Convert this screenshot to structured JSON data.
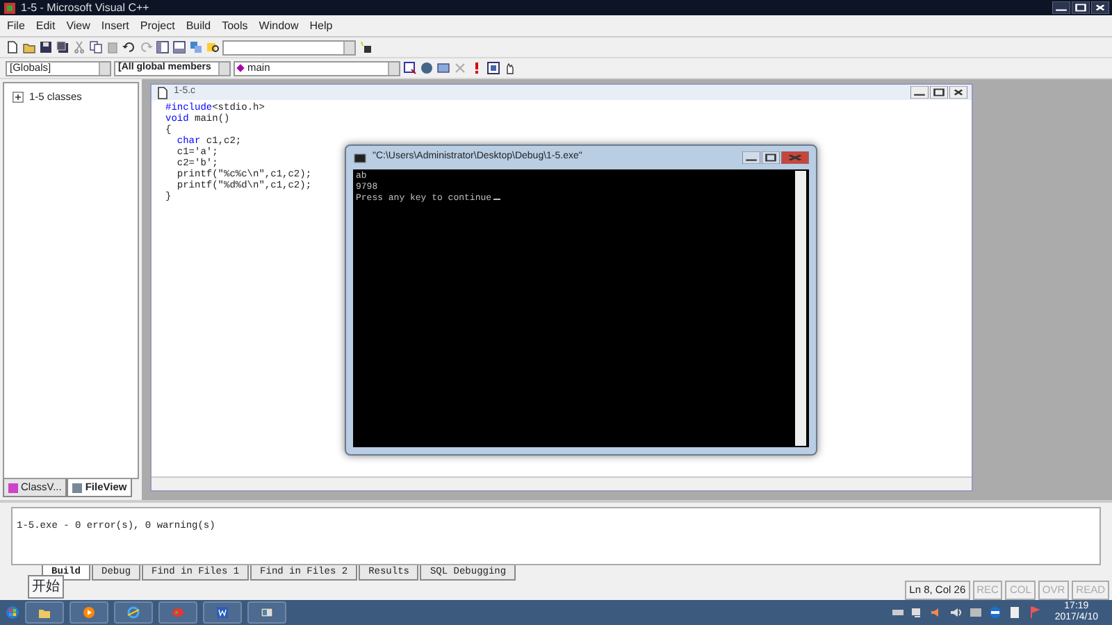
{
  "window": {
    "title": "1-5 - Microsoft Visual C++"
  },
  "menu": [
    "File",
    "Edit",
    "View",
    "Insert",
    "Project",
    "Build",
    "Tools",
    "Window",
    "Help"
  ],
  "wizard_bar": {
    "class_combo": "[Globals]",
    "filter_combo": "[All global members",
    "member_combo": "main"
  },
  "workspace": {
    "tree": [
      {
        "label": "1-5 classes",
        "expanded": false
      }
    ],
    "tabs": [
      {
        "label": "ClassV...",
        "selected": false
      },
      {
        "label": "FileView",
        "selected": true
      }
    ]
  },
  "editor": {
    "title": "1-5.c",
    "lines": [
      {
        "tokens": [
          {
            "kind": "keyword",
            "text": "#include"
          },
          {
            "kind": "plain",
            "text": "<stdio.h>"
          }
        ]
      },
      {
        "tokens": [
          {
            "kind": "keyword",
            "text": "void"
          },
          {
            "kind": "plain",
            "text": " main()"
          }
        ]
      },
      {
        "tokens": [
          {
            "kind": "plain",
            "text": "{"
          }
        ]
      },
      {
        "tokens": [
          {
            "kind": "keyword",
            "text": "  char"
          },
          {
            "kind": "plain",
            "text": " c1,c2;"
          }
        ]
      },
      {
        "tokens": [
          {
            "kind": "plain",
            "text": "  c1='a';"
          }
        ]
      },
      {
        "tokens": [
          {
            "kind": "plain",
            "text": "  c2='b';"
          }
        ]
      },
      {
        "tokens": [
          {
            "kind": "plain",
            "text": "  printf(\"%c%c\\n\",c1,c2);"
          }
        ]
      },
      {
        "tokens": [
          {
            "kind": "plain",
            "text": "  printf(\"%d%d\\n\",c1,c2);"
          }
        ]
      },
      {
        "tokens": [
          {
            "kind": "plain",
            "text": "}"
          }
        ]
      }
    ]
  },
  "console": {
    "title": "\"C:\\Users\\Administrator\\Desktop\\Debug\\1-5.exe\"",
    "lines": [
      "ab",
      "9798",
      "Press any key to continue"
    ]
  },
  "output": {
    "lines": [
      "1-5.exe - 0 error(s), 0 warning(s)"
    ],
    "tabs": [
      {
        "label": "Build",
        "selected": true
      },
      {
        "label": "Debug",
        "selected": false
      },
      {
        "label": "Find in Files 1",
        "selected": false
      },
      {
        "label": "Find in Files 2",
        "selected": false
      },
      {
        "label": "Results",
        "selected": false
      },
      {
        "label": "SQL Debugging",
        "selected": false
      }
    ]
  },
  "tooltip": "开始",
  "status_bar": {
    "position": "Ln 8, Col 26",
    "indicators": [
      {
        "label": "REC",
        "active": false
      },
      {
        "label": "COL",
        "active": false
      },
      {
        "label": "OVR",
        "active": false
      },
      {
        "label": "READ",
        "active": false
      }
    ]
  },
  "taskbar": {
    "time": "17:19",
    "date": "2017/4/10"
  }
}
